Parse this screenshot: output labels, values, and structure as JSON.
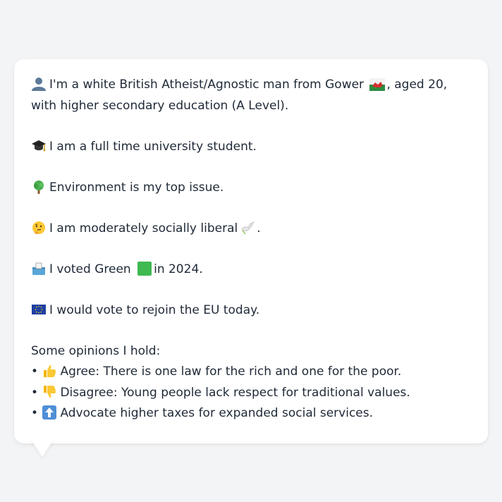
{
  "profile": {
    "identity": {
      "icon": "person-silhouette-icon",
      "text_before_flag": "I'm a white British Atheist/Agnostic man from Gower",
      "flag": "wales-flag-icon",
      "text_after_flag": ", aged 20, with higher secondary education (A Level)."
    },
    "occupation": {
      "icon": "graduation-cap-icon",
      "text": "I am a full time university student."
    },
    "issue": {
      "icon": "tree-icon",
      "text": "Environment is my top issue."
    },
    "social_views": {
      "icon": "thinking-face-icon",
      "text": "I am moderately socially liberal",
      "trailing_icon": "dove-icon",
      "trailing_text": "."
    },
    "vote": {
      "icon": "ballot-box-icon",
      "text_before": "I voted Green",
      "inline_icon": "green-square-icon",
      "text_after": "in 2024."
    },
    "eu": {
      "icon": "eu-flag-icon",
      "text": "I would vote to rejoin the EU today."
    },
    "opinions": {
      "heading": "Some opinions I hold:",
      "bullet": "•",
      "items": [
        {
          "icon": "thumbs-up-icon",
          "text": "Agree: There is one law for the rich and one for the poor."
        },
        {
          "icon": "thumbs-down-icon",
          "text": "Disagree: Young people lack respect for traditional values."
        },
        {
          "icon": "up-arrow-icon",
          "text": "Advocate higher taxes for expanded social services."
        }
      ]
    }
  },
  "colors": {
    "background": "#f3f4f6",
    "card": "#ffffff",
    "text": "#1f2937"
  }
}
